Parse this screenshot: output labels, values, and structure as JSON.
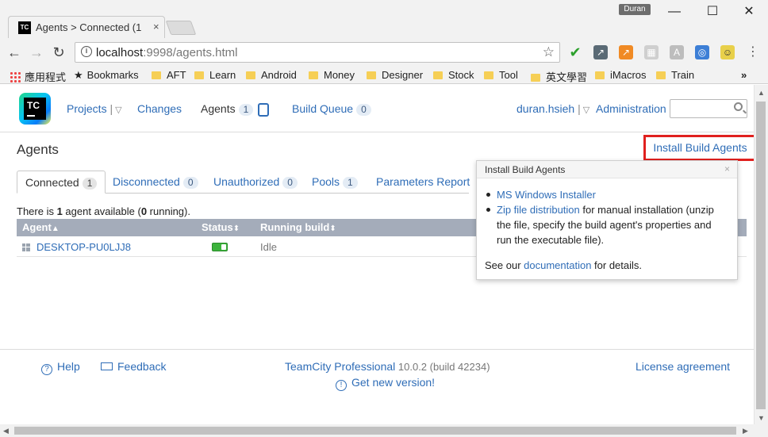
{
  "browser": {
    "tab_title": "Agents > Connected (1",
    "tab_close": "×",
    "profile": "Duran",
    "url_host": "localhost",
    "url_path": ":9998/agents.html",
    "bookmarks": [
      {
        "label": "應用程式",
        "icon": "apps-icon"
      },
      {
        "label": "Bookmarks",
        "icon": "star-icon"
      },
      {
        "label": "AFT",
        "icon": "folder-icon"
      },
      {
        "label": "Learn",
        "icon": "folder-icon"
      },
      {
        "label": "Android",
        "icon": "folder-icon"
      },
      {
        "label": "Money",
        "icon": "folder-icon"
      },
      {
        "label": "Designer",
        "icon": "folder-icon"
      },
      {
        "label": "Stock",
        "icon": "folder-icon"
      },
      {
        "label": "Tool",
        "icon": "folder-icon"
      },
      {
        "label": "英文學習",
        "icon": "folder-icon"
      },
      {
        "label": "iMacros",
        "icon": "folder-icon"
      },
      {
        "label": "Train",
        "icon": "folder-icon"
      }
    ],
    "bookmarks_overflow": "»"
  },
  "header": {
    "logo": "TC",
    "nav": {
      "projects": "Projects",
      "changes": "Changes",
      "agents": "Agents",
      "agents_count": "1",
      "build_queue": "Build Queue",
      "build_queue_count": "0",
      "user": "duran.hsieh",
      "administration": "Administration"
    }
  },
  "main": {
    "title": "Agents",
    "install_button": "Install Build Agents",
    "tabs": [
      {
        "label": "Connected",
        "count": "1"
      },
      {
        "label": "Disconnected",
        "count": "0"
      },
      {
        "label": "Unauthorized",
        "count": "0"
      },
      {
        "label": "Pools",
        "count": "1"
      },
      {
        "label": "Parameters Report",
        "count": ""
      }
    ],
    "summary": {
      "pre": "There is ",
      "count": "1",
      "mid": " agent available (",
      "running": "0",
      "post": " running)."
    },
    "table": {
      "headers": [
        "Agent",
        "Status",
        "Running build"
      ],
      "rows": [
        {
          "agent": "DESKTOP-PU0LJJ8",
          "status": "enabled",
          "running_build": "Idle"
        }
      ]
    }
  },
  "popup": {
    "title": "Install Build Agents",
    "close": "×",
    "item1_link": "MS Windows Installer",
    "item2_link": "Zip file distribution",
    "item2_text": " for manual installation (unzip the file, specify the build agent's properties and run the executable file).",
    "footer_pre": "See our ",
    "footer_link": "documentation",
    "footer_post": " for details."
  },
  "footer": {
    "help": "Help",
    "feedback": "Feedback",
    "product": "TeamCity Professional",
    "version": " 10.0.2 (build 42234)",
    "new_version": "Get new version!",
    "license": "License agreement"
  }
}
